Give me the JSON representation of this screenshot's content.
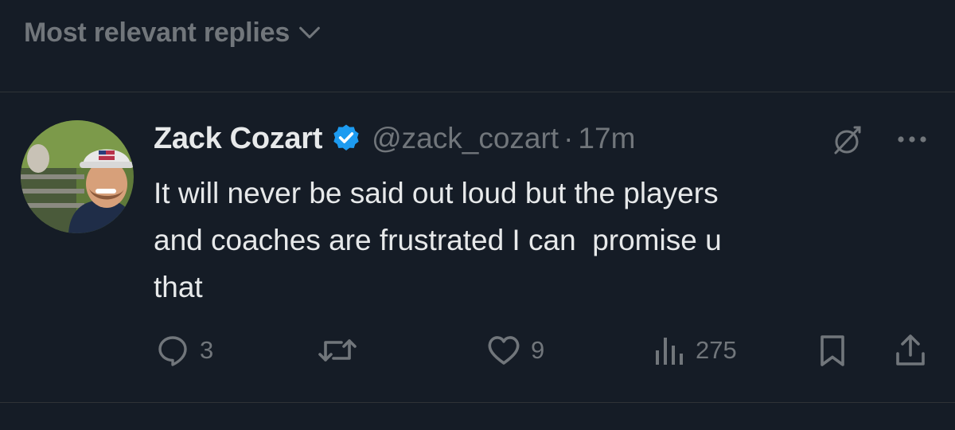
{
  "sort": {
    "label": "Most relevant replies",
    "icon": "chevron-down-icon"
  },
  "tweet": {
    "author": {
      "display_name": "Zack Cozart",
      "handle": "@zack_cozart",
      "verified": true,
      "verified_color": "#1d9bf0"
    },
    "separator": "·",
    "time": "17m",
    "text": "It will never be said out loud but the players\nand coaches are frustrated I can  promise u\nthat",
    "actions": {
      "replies": "3",
      "retweets": "",
      "likes": "9",
      "views": "275"
    },
    "icons": {
      "grok": "grok-icon",
      "more": "more-icon",
      "reply": "reply-icon",
      "retweet": "retweet-icon",
      "like": "heart-icon",
      "views": "views-icon",
      "bookmark": "bookmark-icon",
      "share": "share-icon"
    }
  },
  "colors": {
    "background": "#151c26",
    "text_primary": "#e7e9ea",
    "text_secondary": "#71767b",
    "divider": "#2f3336"
  }
}
